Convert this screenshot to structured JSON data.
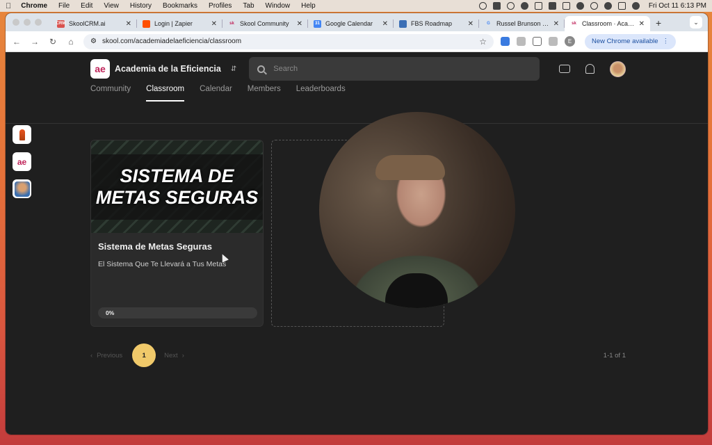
{
  "menubar": {
    "apple_icon": "apple-icon",
    "items": [
      "Chrome",
      "File",
      "Edit",
      "View",
      "History",
      "Bookmarks",
      "Profiles",
      "Tab",
      "Window",
      "Help"
    ],
    "clock": "Fri Oct 11  6:13 PM"
  },
  "browser": {
    "tabs": [
      {
        "title": "SkoolCRM.ai",
        "favicon": "CRM",
        "favicon_color": "#d9534f"
      },
      {
        "title": "Login | Zapier",
        "favicon": "",
        "favicon_color": "#ff4f00"
      },
      {
        "title": "Skool Community",
        "favicon": "sk",
        "favicon_color": "#c0245a"
      },
      {
        "title": "Google Calendar",
        "favicon": "31",
        "favicon_color": "#4285f4"
      },
      {
        "title": "FBS Roadmap",
        "favicon": "",
        "favicon_color": "#3b6fb6"
      },
      {
        "title": "Russel Brunson f...",
        "favicon": "G",
        "favicon_color": "#4285f4"
      },
      {
        "title": "Classroom · Acad...",
        "favicon": "sk",
        "favicon_color": "#c0245a",
        "active": true
      }
    ],
    "url": "skool.com/academiadelaeficiencia/classroom",
    "new_chrome_label": "New Chrome available",
    "profile_initial": "E"
  },
  "header": {
    "logo_text": "ae",
    "group_name": "Academia de la Eficiencia",
    "search_placeholder": "Search"
  },
  "nav": {
    "items": [
      "Community",
      "Classroom",
      "Calendar",
      "Members",
      "Leaderboards"
    ],
    "active_index": 1
  },
  "course": {
    "thumbnail_text": "SISTEMA DE METAS SEGURAS",
    "title": "Sistema de Metas Seguras",
    "description": "El Sistema Que Te Llevará a Tus Metas",
    "progress_label": "0%",
    "progress_fraction": 0
  },
  "pagination": {
    "prev_label": "Previous",
    "current_page": "1",
    "next_label": "Next",
    "count_label": "1-1 of 1"
  }
}
